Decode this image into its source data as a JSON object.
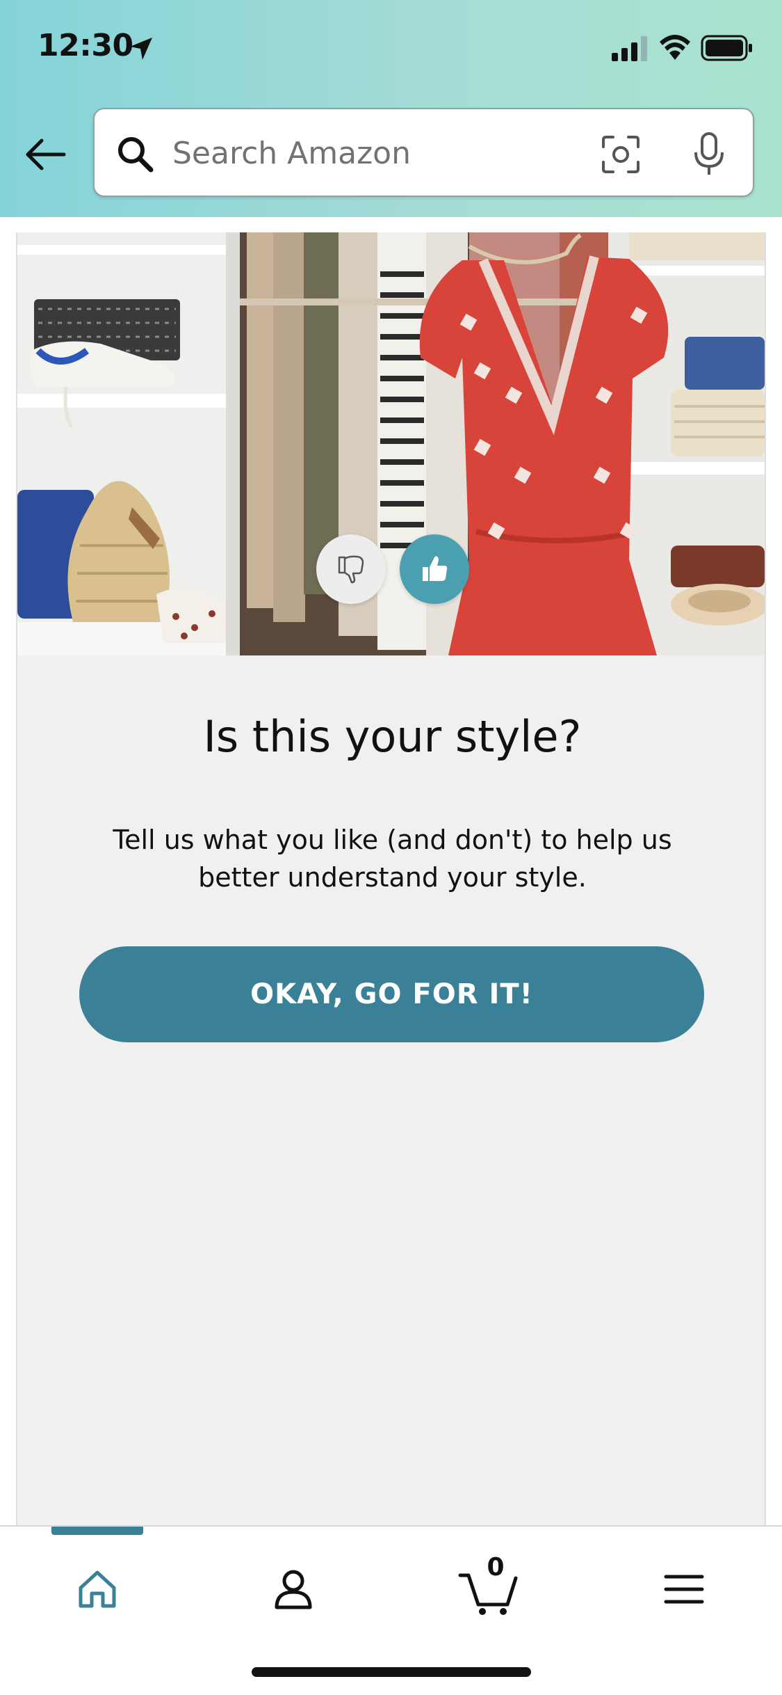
{
  "status_bar": {
    "time": "12:30",
    "icons": [
      "location-arrow-icon",
      "cellular-signal-icon",
      "wifi-icon",
      "battery-icon"
    ]
  },
  "header": {
    "back_icon": "back-arrow-icon",
    "search": {
      "placeholder": "Search Amazon",
      "value": "",
      "icons": [
        "search-icon",
        "camera-scan-icon",
        "microphone-icon"
      ]
    }
  },
  "card": {
    "image": "closet-with-red-dress-photo",
    "vote_buttons": [
      "thumbs-down-icon",
      "thumbs-up-icon"
    ],
    "title": "Is this your style?",
    "subtitle": "Tell us what you like (and don't) to help us better understand your style.",
    "cta_label": "OKAY, GO FOR IT!"
  },
  "bottom_nav": {
    "items": [
      {
        "name": "home",
        "icon": "home-icon",
        "active": true
      },
      {
        "name": "account",
        "icon": "person-icon",
        "active": false
      },
      {
        "name": "cart",
        "icon": "cart-icon",
        "active": false
      },
      {
        "name": "menu",
        "icon": "hamburger-menu-icon",
        "active": false
      }
    ],
    "cart_count": "0"
  },
  "colors": {
    "accent": "#3a8096",
    "thumbs_up": "#4a9fb1",
    "card_background": "#f0f0f0",
    "header_gradient_start": "#84d3d9",
    "header_gradient_end": "#a9e2cf"
  }
}
